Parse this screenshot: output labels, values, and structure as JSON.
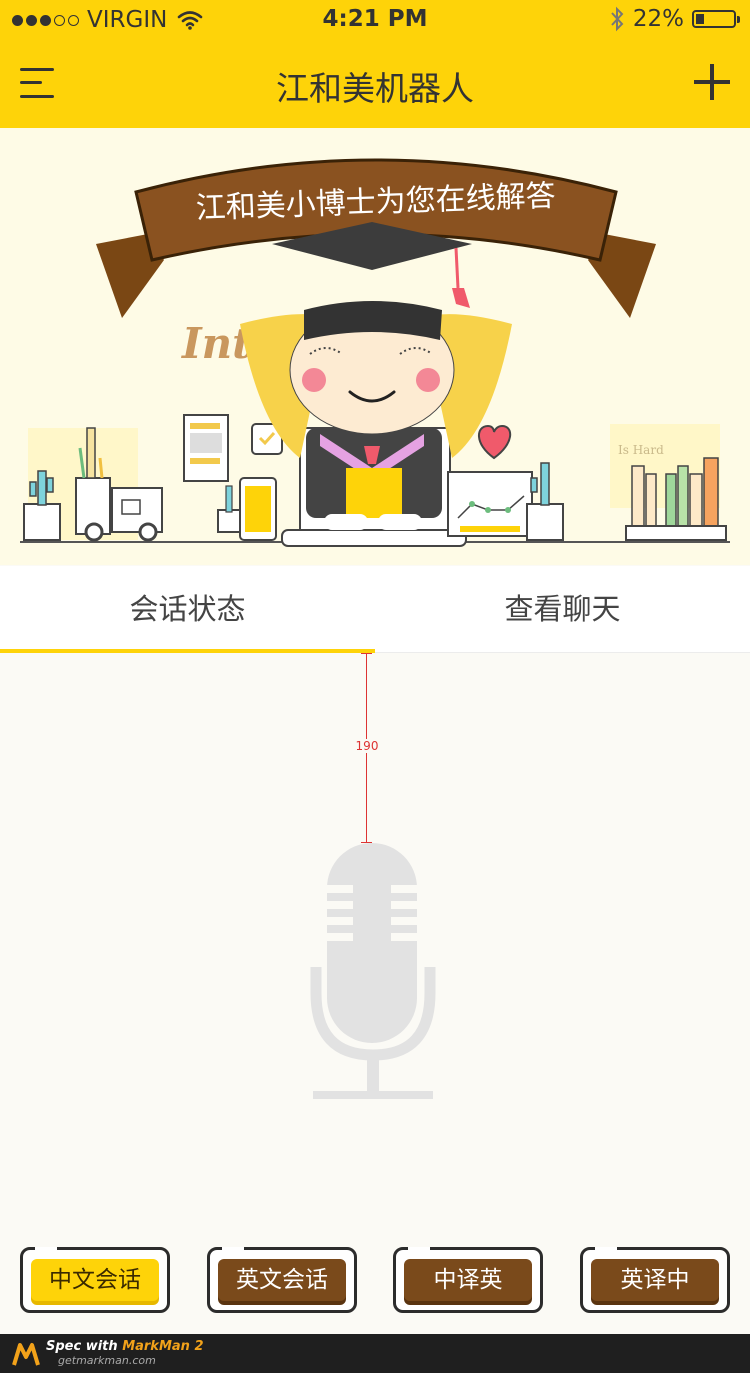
{
  "status_bar": {
    "carrier": "VIRGIN",
    "time": "4:21 PM",
    "battery": "22%",
    "battery_level": 0.22,
    "signal_bars_filled": 3,
    "signal_bars_total": 5
  },
  "navbar": {
    "title": "江和美机器人",
    "menu_icon": "hamburger-menu-icon",
    "add_icon": "plus-icon"
  },
  "hero": {
    "banner_text": "江和美小博士为您在线解答",
    "subtitle_text": "Inte         ot",
    "book_text": "Is Hard"
  },
  "tabs": [
    {
      "label": "会话状态",
      "active": true
    },
    {
      "label": "查看聊天",
      "active": false
    }
  ],
  "measurement": {
    "label": "190"
  },
  "mic": {
    "icon": "microphone-icon"
  },
  "mode_buttons": [
    {
      "label": "中文会话",
      "active": true
    },
    {
      "label": "英文会话",
      "active": false
    },
    {
      "label": "中译英",
      "active": false
    },
    {
      "label": "英译中",
      "active": false
    }
  ],
  "footer": {
    "brand_prefix": "Spec with ",
    "brand_name": "MarkMan 2",
    "url": "getmarkman.com"
  },
  "colors": {
    "accent": "#fed309",
    "brown": "#7a4a1b",
    "mic_gray": "#e2e2e2"
  }
}
